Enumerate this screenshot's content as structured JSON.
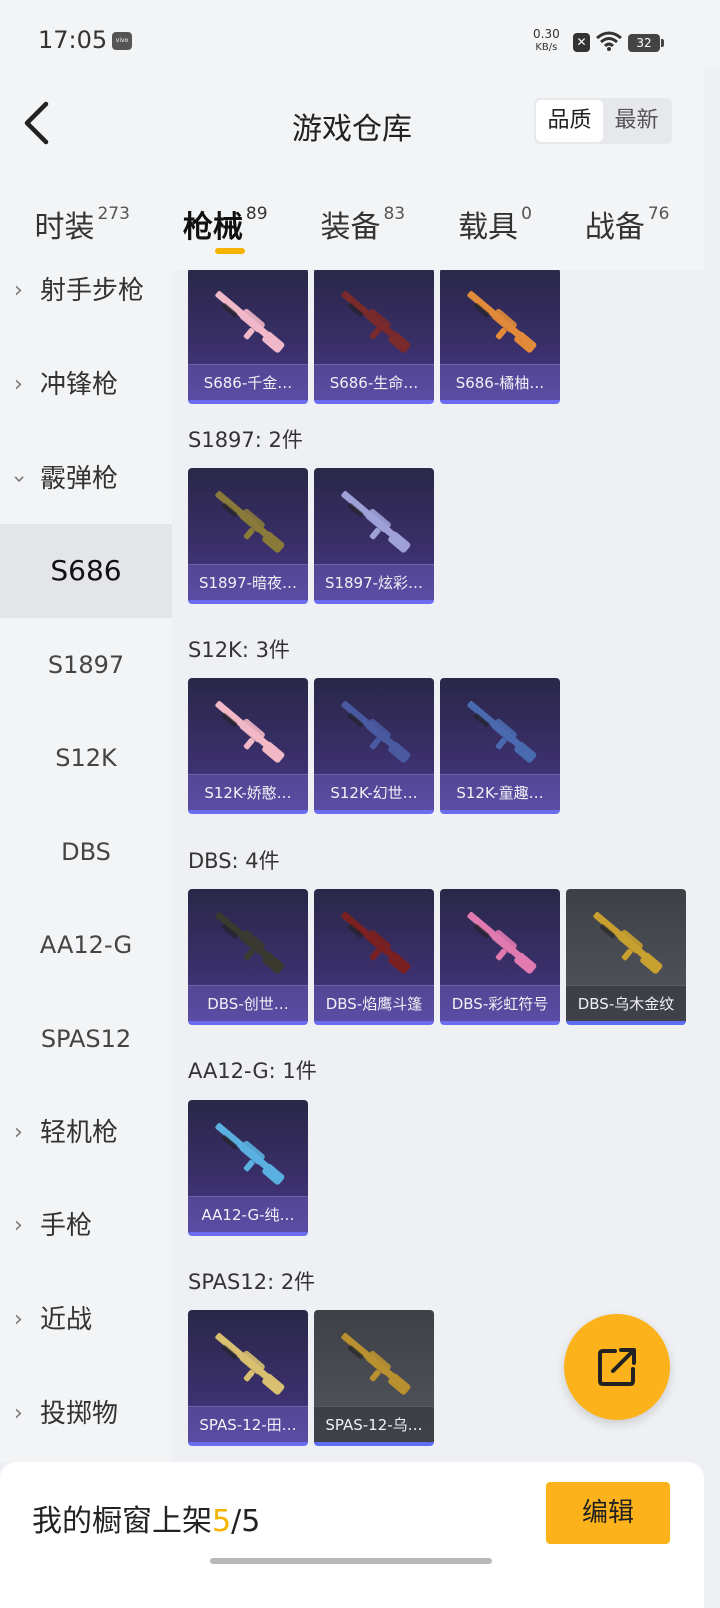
{
  "status_bar": {
    "time": "17:05",
    "brand_icon": "vivo",
    "speed_value": "0.30",
    "speed_unit": "KB/s",
    "battery": "32"
  },
  "header": {
    "title": "游戏仓库",
    "sort_options": [
      "品质",
      "最新"
    ],
    "active_sort": 0
  },
  "tabs": [
    {
      "label": "时装",
      "count": "273"
    },
    {
      "label": "枪械",
      "count": "89",
      "active": true
    },
    {
      "label": "装备",
      "count": "83"
    },
    {
      "label": "载具",
      "count": "0"
    },
    {
      "label": "战备",
      "count": "76"
    }
  ],
  "sidebar": {
    "items": [
      {
        "label": "射手步枪",
        "kind": "category",
        "expanded": false
      },
      {
        "label": "冲锋枪",
        "kind": "category",
        "expanded": false
      },
      {
        "label": "霰弹枪",
        "kind": "category",
        "expanded": true
      },
      {
        "label": "S686",
        "kind": "sub",
        "active": true
      },
      {
        "label": "S1897",
        "kind": "sub"
      },
      {
        "label": "S12K",
        "kind": "sub"
      },
      {
        "label": "DBS",
        "kind": "sub"
      },
      {
        "label": "AA12-G",
        "kind": "sub"
      },
      {
        "label": "SPAS12",
        "kind": "sub"
      },
      {
        "label": "轻机枪",
        "kind": "category",
        "expanded": false
      },
      {
        "label": "手枪",
        "kind": "category",
        "expanded": false
      },
      {
        "label": "近战",
        "kind": "category",
        "expanded": false
      },
      {
        "label": "投掷物",
        "kind": "category",
        "expanded": false
      }
    ]
  },
  "groups": [
    {
      "title": "",
      "items": [
        {
          "name": "S686-千金…",
          "tint": "#f0b8c8",
          "bg": "purple"
        },
        {
          "name": "S686-生命…",
          "tint": "#7a2a2a",
          "bg": "purple"
        },
        {
          "name": "S686-橘柚…",
          "tint": "#e08a3a",
          "bg": "purple"
        }
      ]
    },
    {
      "title": "S1897: 2件",
      "items": [
        {
          "name": "S1897-暗夜…",
          "tint": "#8a7a3a",
          "bg": "purple"
        },
        {
          "name": "S1897-炫彩…",
          "tint": "#a0a0d8",
          "bg": "purple"
        }
      ]
    },
    {
      "title": "S12K: 3件",
      "items": [
        {
          "name": "S12K-娇憨…",
          "tint": "#f2b8c6",
          "bg": "purple"
        },
        {
          "name": "S12K-幻世…",
          "tint": "#4a5aa0",
          "bg": "purple"
        },
        {
          "name": "S12K-童趣…",
          "tint": "#4a6ab0",
          "bg": "purple"
        }
      ]
    },
    {
      "title": "DBS: 4件",
      "items": [
        {
          "name": "DBS-创世…",
          "tint": "#3a3a30",
          "bg": "purple"
        },
        {
          "name": "DBS-焰鹰斗篷",
          "tint": "#7a2020",
          "bg": "purple"
        },
        {
          "name": "DBS-彩虹符号",
          "tint": "#e07ab0",
          "bg": "purple"
        },
        {
          "name": "DBS-乌木金纹",
          "tint": "#c8a030",
          "bg": "gray"
        }
      ]
    },
    {
      "title": "AA12-G: 1件",
      "items": [
        {
          "name": "AA12-G-纯…",
          "tint": "#5ab0e0",
          "bg": "purple"
        }
      ]
    },
    {
      "title": "SPAS12: 2件",
      "items": [
        {
          "name": "SPAS-12-田…",
          "tint": "#d8c070",
          "bg": "purple"
        },
        {
          "name": "SPAS-12-乌…",
          "tint": "#b89030",
          "bg": "gray"
        }
      ]
    }
  ],
  "bottom_bar": {
    "showcase_label": "我的橱窗上架",
    "showcase_count": "5",
    "showcase_total": "/5",
    "edit_label": "编辑"
  }
}
